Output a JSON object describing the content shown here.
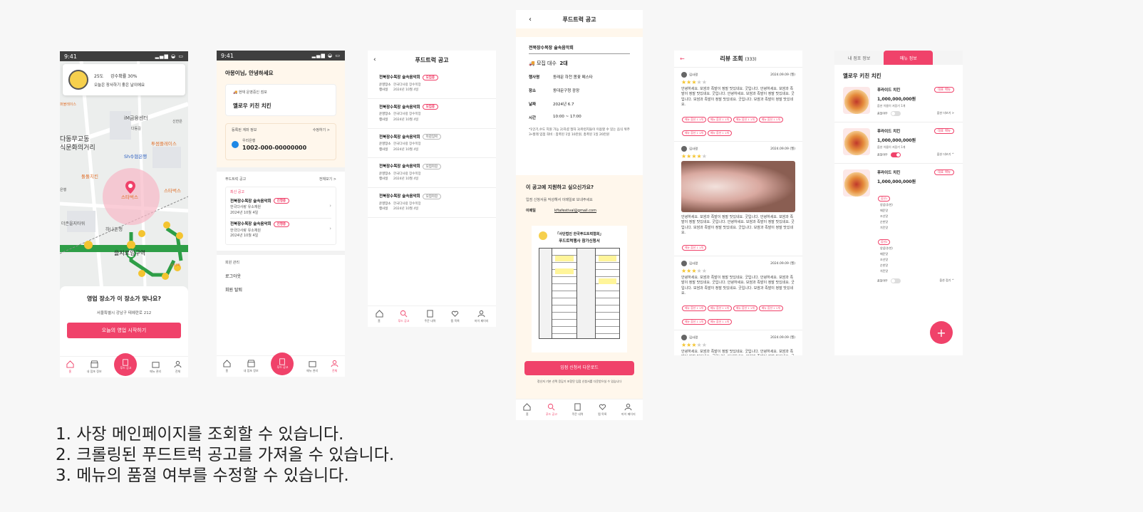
{
  "screen1": {
    "time": "9:41",
    "weather": {
      "temp": "25도",
      "rain": "강수확률 30%",
      "message": "오늘은 장사하기 좋은 날이에요"
    },
    "map_labels": [
      "퍼블레이스",
      "iM금융센터",
      "신한은",
      "다동길",
      "다동무교동",
      "식문화의거리",
      "Sh수협은행",
      "투썸플레이스",
      "돌돌치킨",
      "스타벅스",
      "스타벅스",
      "하나은행",
      "더존을지타워",
      "을지로입구역",
      "스타벅",
      "은행"
    ],
    "question": "영업 장소가 이 장소가 맞나요?",
    "address": "서울특별시 강남구 테헤란로 212",
    "start_button": "오늘의 영업 시작하기",
    "nav": [
      "홈",
      "내 점포 정보",
      "푸드 공고",
      "메뉴 관리",
      "전체"
    ]
  },
  "screen2": {
    "time": "9:41",
    "greeting": "아몽이님, 안녕하세요",
    "current_store_label": "현재 운영중인 점포",
    "store_name": "옐로우 키친 치킨",
    "account_label": "등록된 계좌 정보",
    "account_edit": "수정하기 >",
    "bank_name": "우리은행",
    "account_number": "1002-000-00000000",
    "posts_section": "푸드트럭 공고",
    "posts_more": "전체보기 >",
    "new_post_label": "최신 공고",
    "posts": [
      {
        "title": "전북장수목장 술속음악회",
        "badge": "진행중",
        "org": "한국다사랑 유소재원",
        "date": "2024년 10월 4일"
      },
      {
        "title": "전북장수목장 술속음악회",
        "badge": "진행중",
        "org": "한국다사랑 유소재원",
        "date": "2024년 10월 4일"
      }
    ],
    "member_section": "회원 관리",
    "logout": "로그아웃",
    "withdraw": "회원 탈퇴",
    "nav": [
      "홈",
      "내 점포 정보",
      "푸드 공고",
      "메뉴 관리",
      "전체"
    ]
  },
  "screen3": {
    "title": "푸드트럭 공고",
    "posts": [
      {
        "title": "전북장수목장 술속음악회",
        "badge": "모집중",
        "org": "한국다사랑 장수목장",
        "date": "2024년 10월 4일"
      },
      {
        "title": "전북장수목장 술속음악회",
        "badge": "모집중",
        "org": "한국다사랑 장수목장",
        "date": "2024년 10월 4일"
      },
      {
        "title": "전북장수목장 술속음악회",
        "badge": "마감임박",
        "org": "한국다사랑 장수목장",
        "date": "2024년 10월 4일"
      },
      {
        "title": "전북장수목장 술속음악회",
        "badge": "모집마감",
        "org": "한국다사랑 장수목장",
        "date": "2024년 10월 4일"
      },
      {
        "title": "전북장수목장 술속음악회",
        "badge": "모집마감",
        "org": "한국다사랑 장수목장",
        "date": "2024년 10월 4일"
      }
    ],
    "row_labels": [
      "운영장소",
      "행사일"
    ],
    "nav": [
      "홈",
      "푸드 공고",
      "주문 내역",
      "찜 목록",
      "마이 페이지"
    ]
  },
  "screen4": {
    "title": "푸드트럭 공고",
    "event_title": "전북장수목장 술속음악회",
    "recruit_label": "모집 대수",
    "recruit_count": "2대",
    "fields": [
      {
        "label": "행사명",
        "value": "동래문 하천 봄꽃 페스타"
      },
      {
        "label": "장소",
        "value": "동대문구청 광장"
      },
      {
        "label": "날짜",
        "value": "2024년 6.7"
      },
      {
        "label": "시간",
        "value": "10:00 ~ 17:00"
      }
    ],
    "notice": "*1인기,수도 지원 가능 2)하셨 절차 3)마련지들이 이용할 수 있는 음식 위주 3•할레 입점 희비 : 참폭된 1일 10만원, 총폭된 1일 20만원",
    "apply_title": "이 공고에 지원하고 싶으신가요?",
    "apply_desc": "입점 신청서를 작성해서 이메일로 보내주세요",
    "email_label": "이메일",
    "email": "kftafestival@gmail.com",
    "doc_title_1": "「사단법인 한국푸드트럭협회」",
    "doc_title_2": "푸드트럭행사 참가신청서",
    "download_button": "입점 신청서 다운로드",
    "download_note": "정신저 기본 신택 응답기 포함된 입점 신청서를 다운받으실 수 있습니다",
    "nav": [
      "홈",
      "푸드 공고",
      "주문 내역",
      "찜 목록",
      "마이 페이지"
    ]
  },
  "screen5": {
    "title": "리뷰 조회",
    "count": "(333)",
    "reviews": [
      {
        "name": "김사랑",
        "date": "2024.09.09 (월)",
        "stars": 3,
        "text": "안녕하세요. 보쌈과 족발이 정말 맛있네요. 굿입니다. 안녕하세요. 보쌈과 족발이 정말 맛있네요. 굿입니다. 안녕하세요. 보쌈과 족발이 정말 맛있네요. 굿입니다. 보쌈과 족발이 정말 맛있네요. 굿입니다. 보쌈과 족발이 정말 맛있네요.",
        "chips": [
          "메뉴 옵션 1 1개",
          "메뉴 옵션 1 1개",
          "메뉴 옵션 1 1개",
          "메뉴 옵션 1 1개",
          "메뉴 옵션 1 1개",
          "메뉴 옵션 1 1개"
        ],
        "photo": false
      },
      {
        "name": "김사랑",
        "date": "2024.09.09 (월)",
        "stars": 4,
        "text": "안녕하세요. 보쌈과 족발이 정말 맛있네요. 굿입니다. 안녕하세요. 보쌈과 족발이 정말 맛있네요. 굿입니다. 안녕하세요. 보쌈과 족발이 정말 맛있네요. 굿입니다. 보쌈과 족발이 정말 맛있네요. 굿입니다. 보쌈과 족발이 정말 맛있네요.",
        "chips": [
          "메뉴 옵션 1 1개"
        ],
        "photo": true
      },
      {
        "name": "김사랑",
        "date": "2024.09.09 (월)",
        "stars": 3,
        "text": "안녕하세요. 보쌈과 족발이 정말 맛있네요. 굿입니다. 안녕하세요. 보쌈과 족발이 정말 맛있네요. 굿입니다. 안녕하세요. 보쌈과 족발이 정말 맛있네요. 굿입니다. 보쌈과 족발이 정말 맛있네요. 굿입니다. 보쌈과 족발이 정말 맛있네요.",
        "chips": [
          "메뉴 옵션 1 1개",
          "메뉴 옵션 1 1개",
          "메뉴 옵션 1 1개",
          "메뉴 옵션 1 1개",
          "메뉴 옵션 1 1개",
          "메뉴 옵션 1 1개"
        ],
        "photo": false
      },
      {
        "name": "김사랑",
        "date": "2024.09.09 (월)",
        "stars": 3,
        "text": "안녕하세요. 보쌈과 족발이 정말 맛있네요. 굿입니다. 안녕하세요. 보쌈과 족발이 정말 맛있네요. 굿입니다. 안녕하세요. 보쌈과 족발이 정말 맛있네요. 굿입니다.",
        "chips": [],
        "photo": false
      }
    ]
  },
  "screen6": {
    "tabs": [
      "내 점포 정보",
      "메뉴 정보"
    ],
    "store_name": "옐로우 키친 치킨",
    "menus": [
      {
        "name": "후라이드 치킨",
        "badge": "대표 메뉴",
        "price": "1,000,000,000원",
        "desc": "옵션 이름이 저장기 1개",
        "soldout_label": "품절여부",
        "soldout": false,
        "more": "옵션 더보기 >"
      },
      {
        "name": "후라이드 치킨",
        "badge": "대표 메뉴",
        "price": "1,000,000,000원",
        "desc": "옵션 이름이 저장기 1개",
        "soldout_label": "품절여부",
        "soldout": true,
        "more": "옵션 더보기 ^"
      },
      {
        "name": "후라이드 치킨",
        "badge": "대표 메뉴",
        "price": "1,000,000,000원",
        "desc": "",
        "soldout_label": "품절여부",
        "soldout": false,
        "more": "옵션 접기 ^"
      }
    ],
    "option_groups": [
      {
        "name": "옵션1",
        "items": [
          "양념(추천)",
          "매운맛",
          "조선맛",
          "순한맛",
          "치킨맛"
        ]
      },
      {
        "name": "옵션2",
        "items": [
          "양념(추천)",
          "매운맛",
          "조선맛",
          "순한맛",
          "치킨맛"
        ]
      }
    ],
    "fab": "+"
  },
  "notes": [
    "1. 사장 메인페이지를 조회할 수 있습니다.",
    "2. 크롤링된 푸드트럭 공고를 가져올 수 있습니다.",
    "3. 메뉴의 품절 여부를 수정할 수 있습니다."
  ],
  "colors": {
    "accent": "#f0426a",
    "cream": "#fff7ec",
    "map_green": "#2e9e47"
  }
}
